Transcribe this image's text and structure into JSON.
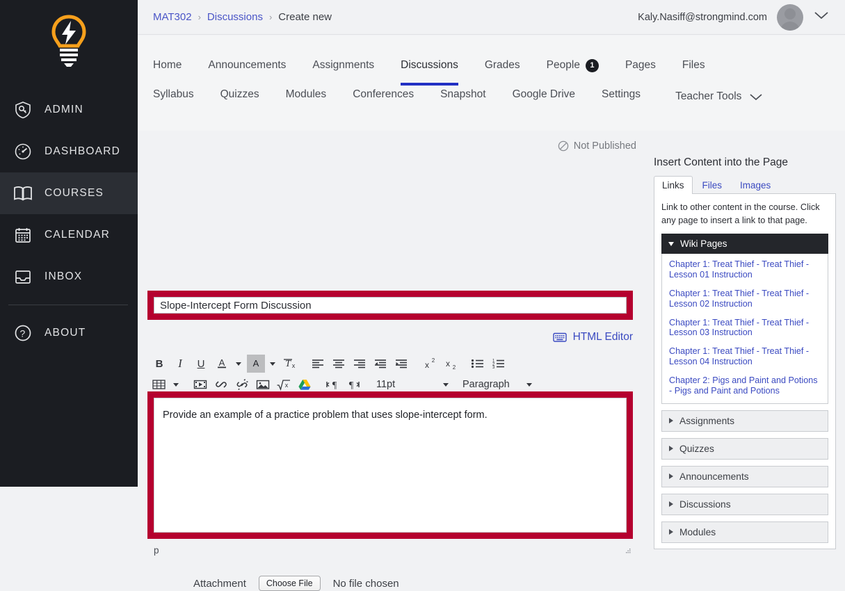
{
  "sidebar": {
    "logo_icon": "lightbulb-logo",
    "items": [
      {
        "label": "ADMIN",
        "icon": "shield-key-icon",
        "active": false
      },
      {
        "label": "DASHBOARD",
        "icon": "gauge-icon",
        "active": false
      },
      {
        "label": "COURSES",
        "icon": "book-icon",
        "active": true
      },
      {
        "label": "CALENDAR",
        "icon": "calendar-icon",
        "active": false
      },
      {
        "label": "INBOX",
        "icon": "inbox-icon",
        "active": false
      },
      {
        "label": "ABOUT",
        "icon": "question-circle-icon",
        "active": false
      }
    ],
    "collapse_icon": "chevron-left-icon"
  },
  "topbar": {
    "breadcrumb": [
      {
        "label": "MAT302",
        "link": true
      },
      {
        "label": "Discussions",
        "link": true
      },
      {
        "label": "Create new",
        "link": false
      }
    ],
    "separator": "›",
    "user_email": "Kaly.Nasiff@strongmind.com",
    "avatar_icon": "user-avatar-icon",
    "chevron_icon": "chevron-down-icon"
  },
  "coursenav": {
    "row1": [
      {
        "label": "Home",
        "active": false
      },
      {
        "label": "Announcements",
        "active": false
      },
      {
        "label": "Assignments",
        "active": false
      },
      {
        "label": "Discussions",
        "active": true
      },
      {
        "label": "Grades",
        "active": false
      },
      {
        "label": "People",
        "active": false,
        "badge": "1"
      },
      {
        "label": "Pages",
        "active": false
      },
      {
        "label": "Files",
        "active": false
      }
    ],
    "row2": [
      {
        "label": "Syllabus"
      },
      {
        "label": "Quizzes"
      },
      {
        "label": "Modules"
      },
      {
        "label": "Conferences"
      },
      {
        "label": "Snapshot"
      },
      {
        "label": "Google Drive"
      },
      {
        "label": "Settings"
      }
    ],
    "teacher_tools": "Teacher Tools",
    "teacher_tools_icon": "chevron-down-icon",
    "active_underline_color": "#2230c4"
  },
  "main": {
    "publish_status": "Not Published",
    "publish_status_icon": "no-entry-icon",
    "title_value": "Slope-Intercept Form Discussion",
    "title_placeholder": "Topic Title",
    "highlight_color": "#b5002f",
    "html_editor_label": "HTML Editor",
    "html_editor_icon": "keyboard-icon",
    "editor_text": "Provide an example of a practice problem that uses slope-intercept form.",
    "editor_status_path": "p",
    "resize_icon": "resize-grip-icon",
    "attachment_label": "Attachment",
    "choose_file_label": "Choose File",
    "no_file_label": "No file chosen"
  },
  "toolbar": {
    "row1": [
      {
        "icon": "bold-icon",
        "glyph": "B",
        "style": "bold"
      },
      {
        "icon": "italic-icon",
        "glyph": "I",
        "style": "italic"
      },
      {
        "icon": "underline-icon",
        "glyph": "U",
        "style": "underline"
      },
      {
        "icon": "text-color-icon",
        "glyph": "A",
        "caret": true
      },
      {
        "icon": "highlight-color-icon",
        "glyph": "A",
        "caret": true,
        "boxed": true
      },
      {
        "icon": "clear-formatting-icon",
        "glyph": "Tx"
      },
      {
        "icon": "align-left-icon"
      },
      {
        "icon": "align-center-icon"
      },
      {
        "icon": "align-right-icon"
      },
      {
        "icon": "outdent-icon"
      },
      {
        "icon": "indent-icon"
      },
      {
        "icon": "superscript-icon",
        "glyph": "x2"
      },
      {
        "icon": "subscript-icon",
        "glyph": "x2"
      },
      {
        "icon": "bullet-list-icon"
      },
      {
        "icon": "numbered-list-icon"
      }
    ],
    "row2": [
      {
        "icon": "table-icon",
        "caret": true
      },
      {
        "icon": "media-icon"
      },
      {
        "icon": "link-icon"
      },
      {
        "icon": "unlink-icon"
      },
      {
        "icon": "image-icon"
      },
      {
        "icon": "math-equation-icon"
      },
      {
        "icon": "google-drive-icon"
      },
      {
        "icon": "ltr-direction-icon"
      },
      {
        "icon": "rtl-direction-icon"
      }
    ],
    "font_size_value": "11pt",
    "block_format_value": "Paragraph"
  },
  "right_panel": {
    "title": "Insert Content into the Page",
    "tabs": [
      {
        "label": "Links",
        "active": true
      },
      {
        "label": "Files",
        "active": false
      },
      {
        "label": "Images",
        "active": false
      }
    ],
    "description": "Link to other content in the course. Click any page to insert a link to that page.",
    "wiki_section": {
      "label": "Wiki Pages",
      "expanded": true,
      "toggle_icon": "triangle-down-icon",
      "links": [
        "Chapter 1: Treat Thief - Treat Thief - Lesson 01 Instruction",
        "Chapter 1: Treat Thief - Treat Thief - Lesson 02 Instruction",
        "Chapter 1: Treat Thief - Treat Thief - Lesson 03 Instruction",
        "Chapter 1: Treat Thief - Treat Thief - Lesson 04 Instruction",
        "Chapter 2: Pigs and Paint and Potions - Pigs and Paint and Potions"
      ]
    },
    "sections": [
      {
        "label": "Assignments",
        "expanded": false,
        "toggle_icon": "triangle-right-icon"
      },
      {
        "label": "Quizzes",
        "expanded": false,
        "toggle_icon": "triangle-right-icon"
      },
      {
        "label": "Announcements",
        "expanded": false,
        "toggle_icon": "triangle-right-icon"
      },
      {
        "label": "Discussions",
        "expanded": false,
        "toggle_icon": "triangle-right-icon"
      },
      {
        "label": "Modules",
        "expanded": false,
        "toggle_icon": "triangle-right-icon"
      }
    ]
  }
}
